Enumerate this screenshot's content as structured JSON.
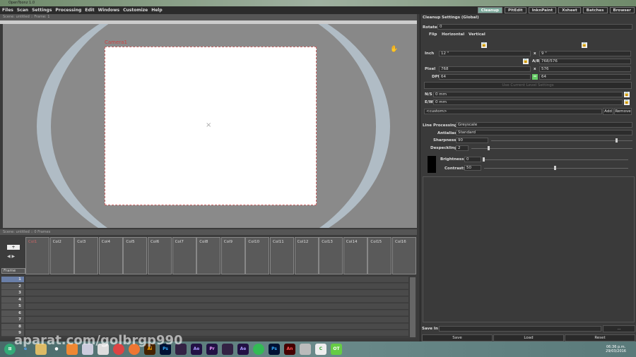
{
  "title": "OpenToonz 1.0",
  "menu": [
    "Files",
    "Scan",
    "Settings",
    "Processing",
    "Edit",
    "Windows",
    "Customize",
    "Help"
  ],
  "rooms": [
    "Cleanup",
    "PltEdit",
    "InknPaint",
    "Xsheet",
    "Batches",
    "Browser"
  ],
  "viewer": {
    "header": "Scene: untitled  ::  Frame: 1",
    "camera": "Camera1"
  },
  "xsheet": {
    "header": "Scene: untitled  ::  0 Frames",
    "frame_label": "Frame",
    "columns": [
      "Col1",
      "Col2",
      "Col3",
      "Col4",
      "Col5",
      "Col6",
      "Col7",
      "Col8",
      "Col9",
      "Col10",
      "Col11",
      "Col12",
      "Col13",
      "Col14",
      "Col15",
      "Col16"
    ],
    "rows": [
      "1",
      "2",
      "3",
      "4",
      "5",
      "6",
      "7",
      "8",
      "9"
    ]
  },
  "cleanup": {
    "title": "Cleanup Settings (Global)",
    "rotate_label": "Rotate",
    "rotate": "0",
    "flip_label": "Flip",
    "horizontal": "Horizontal",
    "vertical": "Vertical",
    "inch_label": "Inch",
    "inch_w": "12 \"",
    "inch_h": "9 \"",
    "x": "x",
    "ar_label": "A/R",
    "ar": "768/576",
    "pixel_label": "Pixel",
    "pixel_w": "768",
    "pixel_h": "576",
    "dpi_label": "DPI",
    "dpi_w": "64",
    "dpi_h": "64",
    "use_current": "Use Current Level Settings",
    "ns_label": "N/S",
    "ns": "0 mm",
    "ew_label": "E/W",
    "ew": "0 mm",
    "preset": "<custom>",
    "add": "Add",
    "remove": "Remove",
    "line_processing_label": "Line Processing:",
    "line_processing": "Greyscale",
    "antialias_label": "Antialias:",
    "antialias": "Standard",
    "sharpness_label": "Sharpness:",
    "sharpness": "90",
    "despeckling_label": "Despeckling:",
    "despeckling": "2",
    "brightness_label": "Brightness:",
    "brightness": "0",
    "contrast_label": "Contrast:",
    "contrast": "50",
    "save_in_label": "Save In",
    "browse": "...",
    "save": "Save",
    "load": "Load",
    "reset": "Reset"
  },
  "taskbar": {
    "apps": [
      "Ai",
      "Ps",
      "Ae",
      "Pr",
      "Ae",
      "Ps",
      "An",
      "OT"
    ],
    "time": "06:36 p.m.",
    "date": "29/03/2016"
  },
  "watermark": "aparat.com/golbrgp990"
}
